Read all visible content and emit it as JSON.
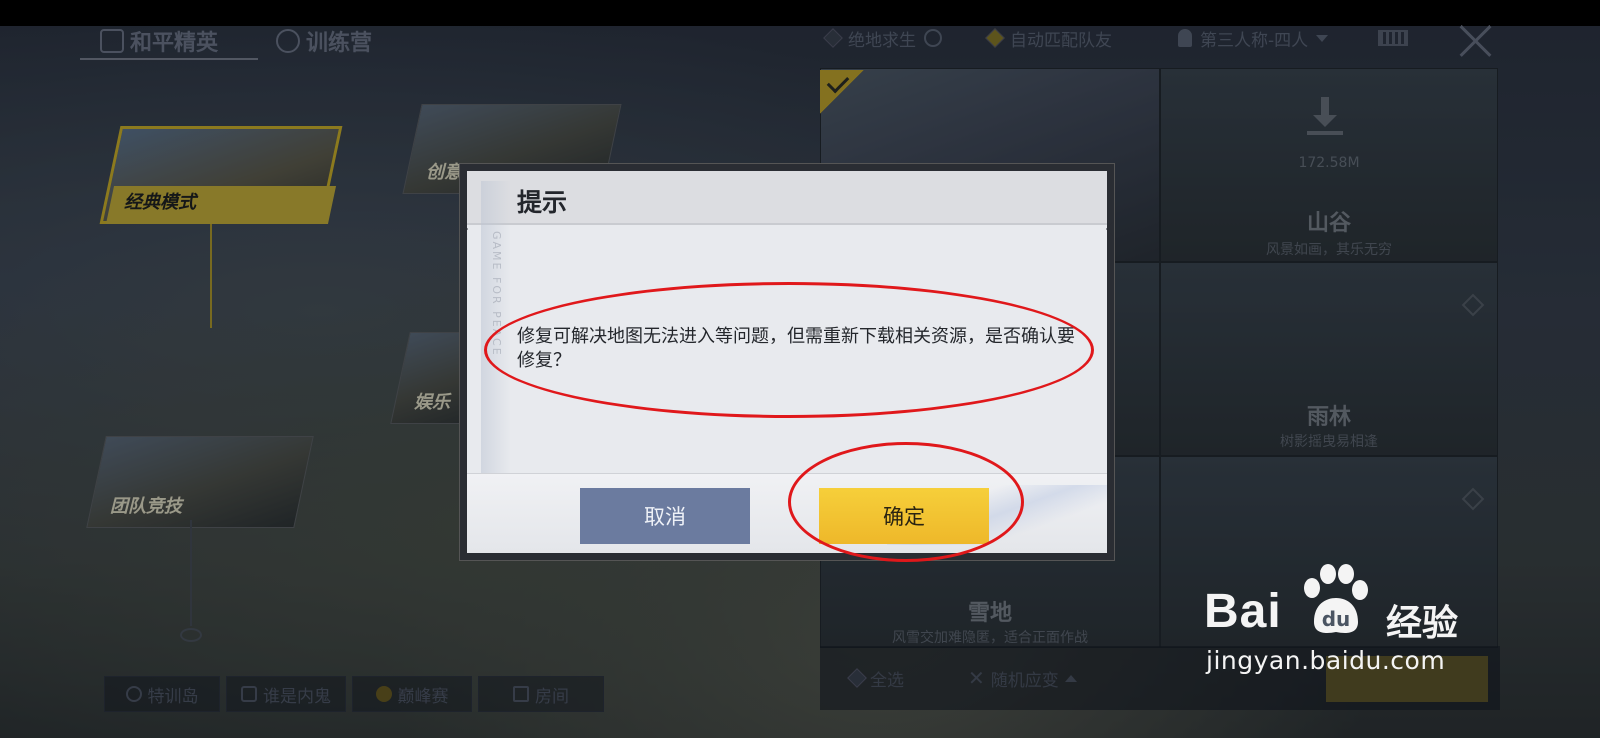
{
  "top_tabs": [
    {
      "label": "和平精英"
    },
    {
      "label": "训练营"
    }
  ],
  "top_right": {
    "item1": "绝地求生",
    "item2": "自动匹配队友",
    "item3": "第三人称-四人"
  },
  "modes": {
    "classic": "经典模式",
    "create": "创意",
    "entertain": "娱乐",
    "team": "团队竞技"
  },
  "maps": {
    "valley": {
      "name": "山谷",
      "desc": "风景如画，其乐无穷",
      "size": "172.58M"
    },
    "rainforest": {
      "name": "雨林",
      "desc": "树影摇曳易相逢"
    },
    "snow": {
      "name": "雪地",
      "desc": "风雪交加难隐匿，适合正面作战"
    }
  },
  "bottom_nav": [
    {
      "label": "特训岛"
    },
    {
      "label": "谁是内鬼"
    },
    {
      "label": "巅峰赛"
    },
    {
      "label": "房间"
    }
  ],
  "bottom_right": {
    "select_all": "全选",
    "random": "随机应变"
  },
  "dialog": {
    "title": "提示",
    "deco_text": "GAME FOR PEACE",
    "message": "修复可解决地图无法进入等问题，但需重新下载相关资源，是否确认要修复？",
    "cancel": "取消",
    "confirm": "确定"
  },
  "watermark": {
    "brand": "Bai",
    "product": "经验",
    "url": "jingyan.baidu.com"
  },
  "colors": {
    "annotation": "#e0181b",
    "confirm_button": "#f2c232",
    "cancel_button": "#6b7b9f"
  }
}
